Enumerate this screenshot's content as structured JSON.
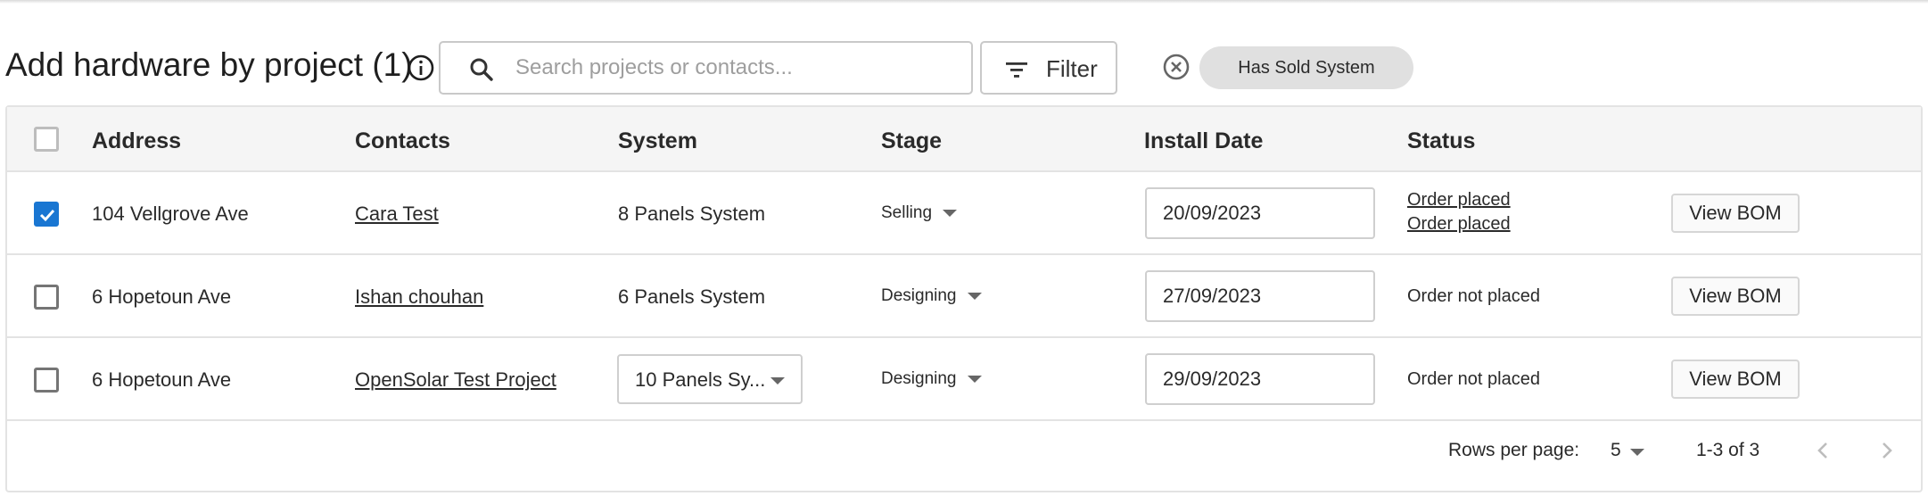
{
  "header": {
    "title": "Add hardware by project (1)",
    "search_placeholder": "Search projects or contacts...",
    "filter_label": "Filter",
    "active_filter_chip": "Has Sold System"
  },
  "table": {
    "columns": [
      "Address",
      "Contacts",
      "System",
      "Stage",
      "Install Date",
      "Status"
    ],
    "rows": [
      {
        "checked": true,
        "address": "104 Vellgrove Ave",
        "contact": "Cara Test",
        "system": "8 Panels System",
        "stage": "Selling",
        "install_date": "20/09/2023",
        "status_lines": [
          "Order placed",
          "Order placed"
        ],
        "action": "View BOM"
      },
      {
        "checked": false,
        "address": "6 Hopetoun Ave",
        "contact": "Ishan chouhan",
        "system": "6 Panels System",
        "stage": "Designing",
        "install_date": "27/09/2023",
        "status": "Order not placed",
        "action": "View BOM"
      },
      {
        "checked": false,
        "address": "6 Hopetoun Ave",
        "contact": "OpenSolar Test Project",
        "system_selected": "10 Panels Sy...",
        "stage": "Designing",
        "install_date": "29/09/2023",
        "status": "Order not placed",
        "action": "View BOM"
      }
    ]
  },
  "pagination": {
    "rows_per_page_label": "Rows per page:",
    "rows_per_page": "5",
    "range": "1-3 of 3"
  },
  "colors": {
    "accent": "#1976d2",
    "chip_bg": "#e0e0e0",
    "header_bg": "#f5f5f5",
    "border": "#e3e3e3"
  },
  "icons": {
    "info": "info-icon",
    "search": "search-icon",
    "filter": "filter-icon",
    "chip_remove": "close-circle-icon",
    "check": "check-icon",
    "prev": "chevron-left-icon",
    "next": "chevron-right-icon"
  }
}
